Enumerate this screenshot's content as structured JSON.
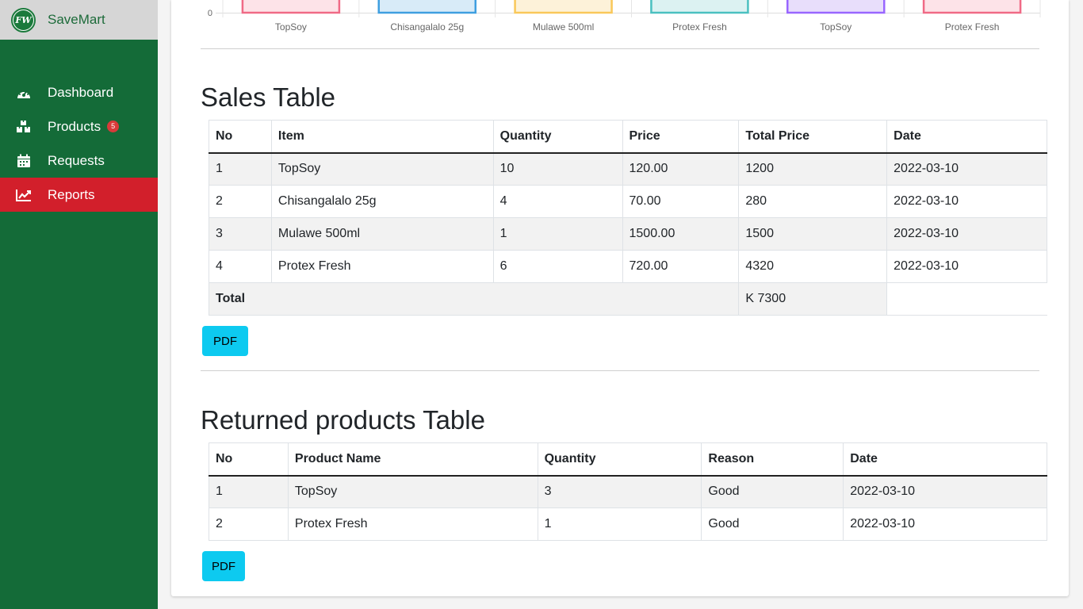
{
  "brand": {
    "name": "SaveMart",
    "logo_text": "FW"
  },
  "sidebar": {
    "items": [
      {
        "label": "Dashboard",
        "icon": "gauge-icon"
      },
      {
        "label": "Products",
        "icon": "boxes-icon",
        "badge": "5"
      },
      {
        "label": "Requests",
        "icon": "calendar-icon"
      },
      {
        "label": "Reports",
        "icon": "chart-line-icon",
        "active": true
      }
    ]
  },
  "chart_data": {
    "type": "bar",
    "categories": [
      "TopSoy",
      "Chisangalalo 25g",
      "Mulawe 500ml",
      "Protex Fresh",
      "TopSoy",
      "Protex Fresh"
    ],
    "y_tick_visible": "0",
    "colors_fill": [
      "#fde3e8",
      "#d8ebf8",
      "#fdf2d9",
      "#dcf2f2",
      "#e8defb",
      "#fde3e8"
    ],
    "colors_border": [
      "#f06a86",
      "#3f9fe0",
      "#f9c85a",
      "#4bc0c0",
      "#9966ff",
      "#f06a86"
    ]
  },
  "sales": {
    "title": "Sales Table",
    "headers": [
      "No",
      "Item",
      "Quantity",
      "Price",
      "Total Price",
      "Date"
    ],
    "rows": [
      [
        "1",
        "TopSoy",
        "10",
        "120.00",
        "1200",
        "2022-03-10"
      ],
      [
        "2",
        "Chisangalalo 25g",
        "4",
        "70.00",
        "280",
        "2022-03-10"
      ],
      [
        "3",
        "Mulawe 500ml",
        "1",
        "1500.00",
        "1500",
        "2022-03-10"
      ],
      [
        "4",
        "Protex Fresh",
        "6",
        "720.00",
        "4320",
        "2022-03-10"
      ]
    ],
    "total_label": "Total",
    "total_value": "K 7300",
    "pdf_label": "PDF"
  },
  "returns": {
    "title": "Returned products Table",
    "headers": [
      "No",
      "Product Name",
      "Quantity",
      "Reason",
      "Date"
    ],
    "rows": [
      [
        "1",
        "TopSoy",
        "3",
        "Good",
        "2022-03-10"
      ],
      [
        "2",
        "Protex Fresh",
        "1",
        "Good",
        "2022-03-10"
      ]
    ],
    "pdf_label": "PDF"
  }
}
